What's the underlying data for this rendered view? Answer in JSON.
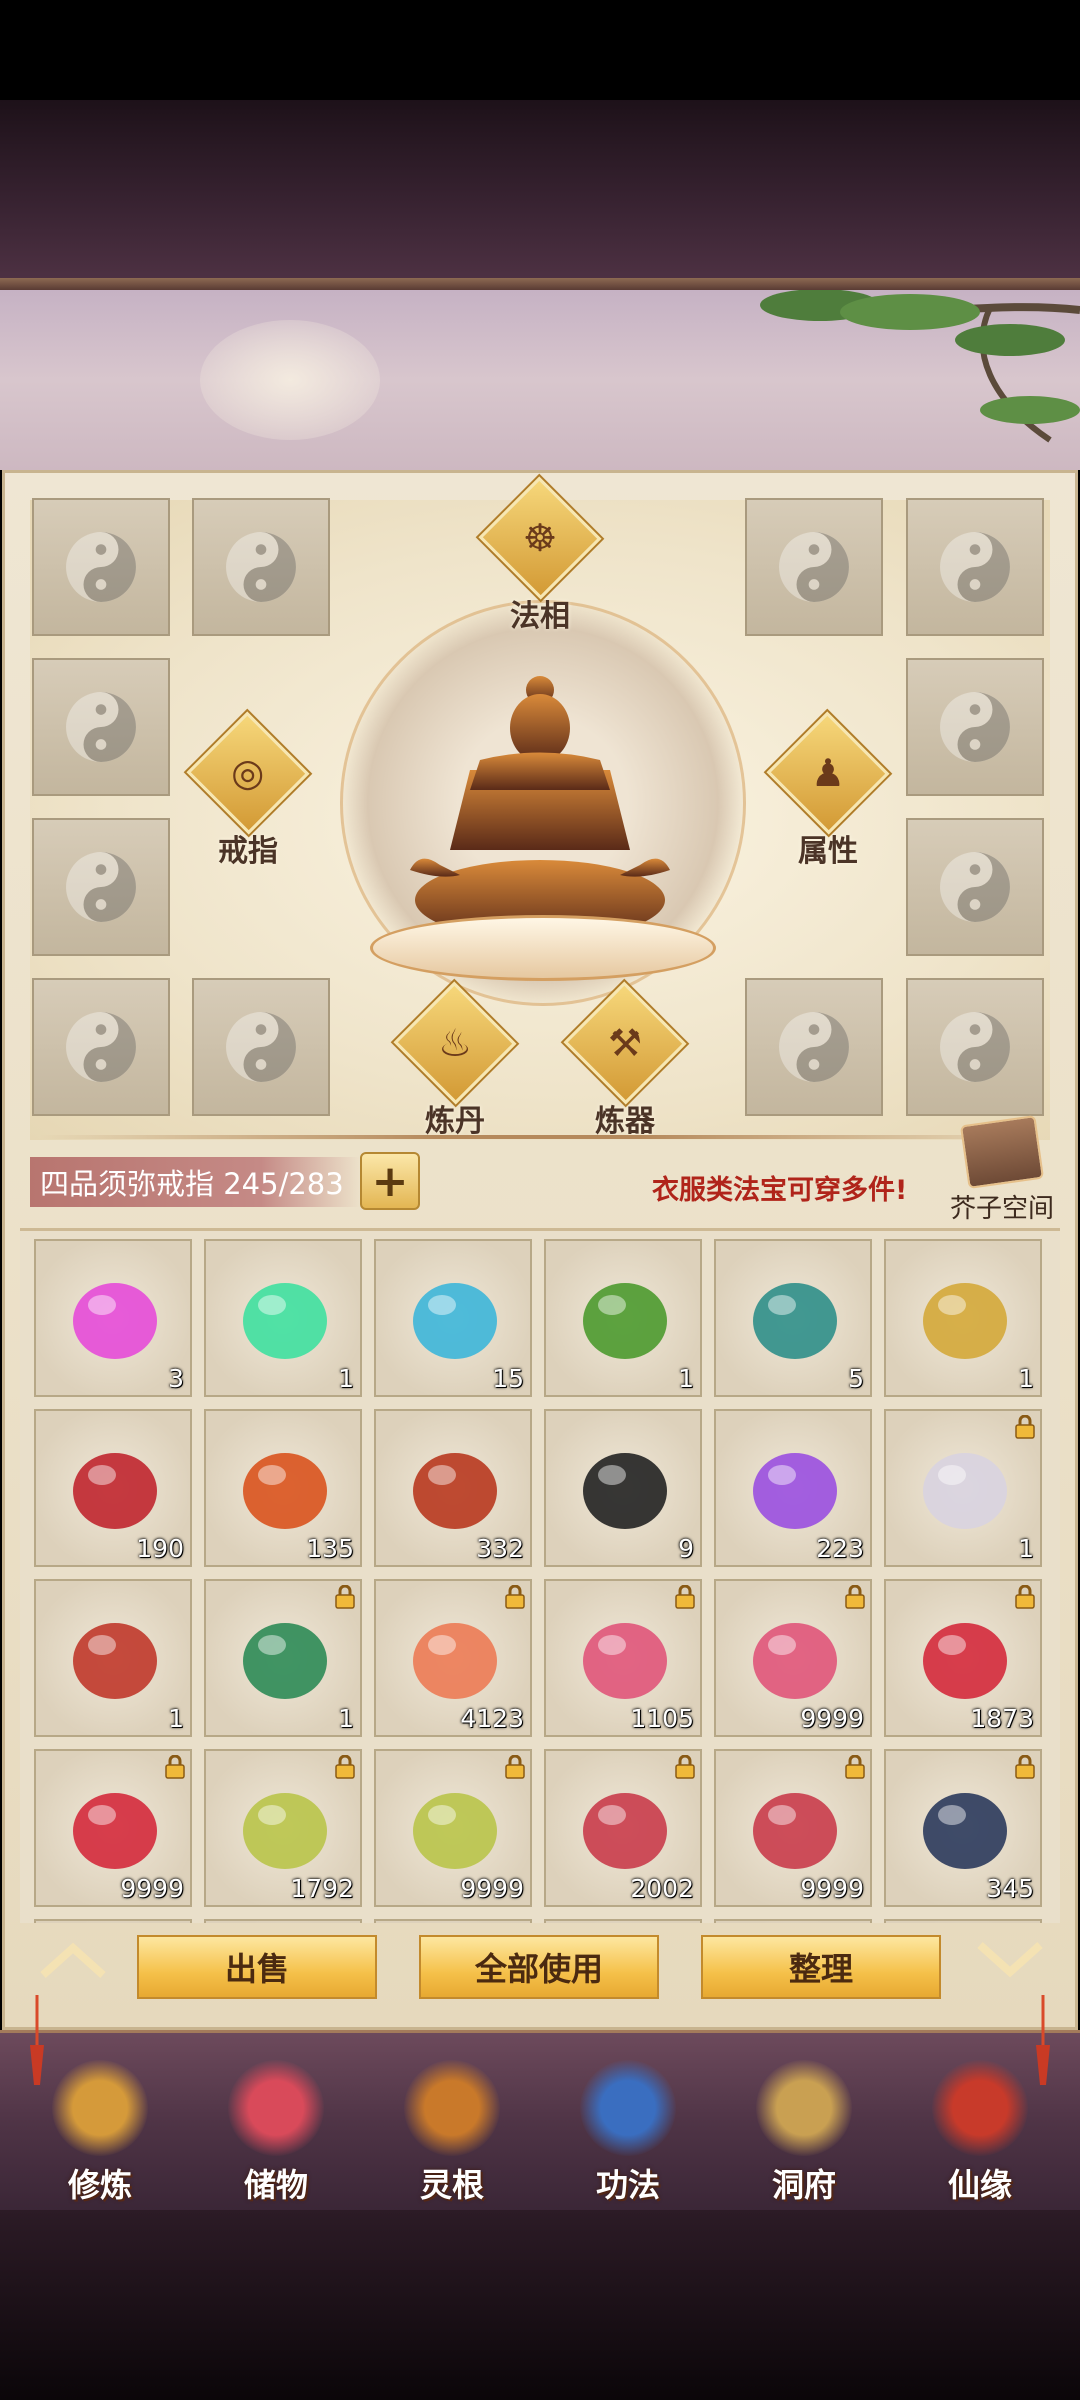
{
  "equip": {
    "center_labels": {
      "faxiang": "法相",
      "ring": "戒指",
      "attr": "属性",
      "alchemy": "炼丹",
      "forge": "炼器"
    }
  },
  "ring_bar": {
    "label": "四品须弥戒指 245/283",
    "plus": "+"
  },
  "hint": "衣服类法宝可穿多件!",
  "mustard_space": "芥子空间",
  "inventory": [
    {
      "icon": "pink-flame-icon",
      "qty": "3",
      "locked": false,
      "color": "#e64bd8"
    },
    {
      "icon": "green-flame-icon",
      "qty": "1",
      "locked": false,
      "color": "#3fe0a0"
    },
    {
      "icon": "water-drop-leaf-icon",
      "qty": "15",
      "locked": false,
      "color": "#3db6d9"
    },
    {
      "icon": "green-tree-icon",
      "qty": "1",
      "locked": false,
      "color": "#4c9a2f"
    },
    {
      "icon": "teal-tree-icon",
      "qty": "5",
      "locked": false,
      "color": "#2f8f8a"
    },
    {
      "icon": "golden-tree-icon",
      "qty": "1",
      "locked": false,
      "color": "#d4a83a"
    },
    {
      "icon": "red-crystal-icon",
      "qty": "190",
      "locked": false,
      "color": "#c0262f"
    },
    {
      "icon": "phoenix-feather-icon",
      "qty": "135",
      "locked": false,
      "color": "#d9531e"
    },
    {
      "icon": "red-teapot-icon",
      "qty": "332",
      "locked": false,
      "color": "#b8381f"
    },
    {
      "icon": "black-orb-icon",
      "qty": "9",
      "locked": false,
      "color": "#222222"
    },
    {
      "icon": "purple-crystal-icon",
      "qty": "223",
      "locked": false,
      "color": "#9a4fe0"
    },
    {
      "icon": "silver-armor-icon",
      "qty": "1",
      "locked": true,
      "color": "#d8d3e0"
    },
    {
      "icon": "red-robe-icon",
      "qty": "1",
      "locked": false,
      "color": "#c0392b"
    },
    {
      "icon": "flower-robe-icon",
      "qty": "1",
      "locked": true,
      "color": "#2e8b57"
    },
    {
      "icon": "peach-icon",
      "qty": "4123",
      "locked": true,
      "color": "#ec7b55"
    },
    {
      "icon": "pink-fruit-icon",
      "qty": "1105",
      "locked": true,
      "color": "#e0557a"
    },
    {
      "icon": "pink-fruit-icon",
      "qty": "9999",
      "locked": true,
      "color": "#e0557a"
    },
    {
      "icon": "raspberry-icon",
      "qty": "1873",
      "locked": true,
      "color": "#d42a3c"
    },
    {
      "icon": "raspberry-icon",
      "qty": "9999",
      "locked": true,
      "color": "#d42a3c"
    },
    {
      "icon": "lotus-fruit-icon",
      "qty": "1792",
      "locked": true,
      "color": "#b9c44a"
    },
    {
      "icon": "lotus-fruit-icon",
      "qty": "9999",
      "locked": true,
      "color": "#b9c44a"
    },
    {
      "icon": "pomegranate-icon",
      "qty": "2002",
      "locked": true,
      "color": "#c93c4b"
    },
    {
      "icon": "pomegranate-icon",
      "qty": "9999",
      "locked": true,
      "color": "#c93c4b"
    },
    {
      "icon": "yin-yang-compass-icon",
      "qty": "345",
      "locked": true,
      "color": "#2b3a5c"
    }
  ],
  "actions": {
    "sell": "出售",
    "use_all": "全部使用",
    "arrange": "整理"
  },
  "nav": [
    {
      "label": "修炼",
      "icon": "cultivate-icon",
      "color": "#d59a3a"
    },
    {
      "label": "储物",
      "icon": "storage-bag-icon",
      "color": "#d94a5a"
    },
    {
      "label": "灵根",
      "icon": "spirit-root-icon",
      "color": "#c9792a"
    },
    {
      "label": "功法",
      "icon": "skill-book-icon",
      "color": "#3a6ec0"
    },
    {
      "label": "洞府",
      "icon": "cave-palace-icon",
      "color": "#c9a052"
    },
    {
      "label": "仙缘",
      "icon": "immortal-gourd-icon",
      "color": "#c83a2a"
    }
  ]
}
